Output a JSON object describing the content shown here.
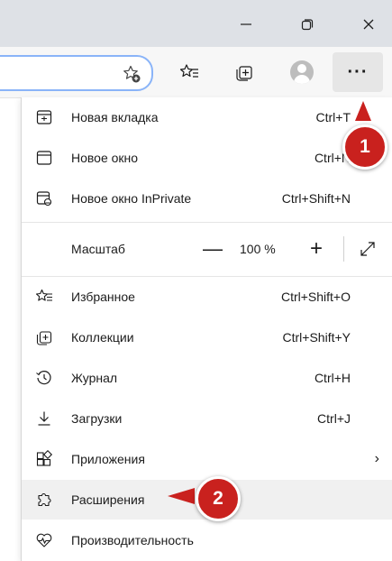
{
  "window_controls": {
    "minimize_icon": "minimize-icon",
    "restore_icon": "restore-icon",
    "close_icon": "close-icon"
  },
  "toolbar": {
    "favorites_add_icon": "star-add-icon",
    "favorites_icon": "favorites-icon",
    "collections_icon": "collections-icon",
    "profile_icon": "profile-avatar",
    "more_label": "···"
  },
  "menu": {
    "new_tab": {
      "label": "Новая вкладка",
      "shortcut": "Ctrl+T"
    },
    "new_window": {
      "label": "Новое окно",
      "shortcut": "Ctrl+N"
    },
    "new_private": {
      "label": "Новое окно InPrivate",
      "shortcut": "Ctrl+Shift+N"
    },
    "zoom": {
      "label": "Масштаб",
      "minus": "—",
      "value": "100 %",
      "plus": "+"
    },
    "favorites": {
      "label": "Избранное",
      "shortcut": "Ctrl+Shift+O"
    },
    "collections": {
      "label": "Коллекции",
      "shortcut": "Ctrl+Shift+Y"
    },
    "history": {
      "label": "Журнал",
      "shortcut": "Ctrl+H"
    },
    "downloads": {
      "label": "Загрузки",
      "shortcut": "Ctrl+J"
    },
    "apps": {
      "label": "Приложения",
      "chevron": "›"
    },
    "extensions": {
      "label": "Расширения"
    },
    "performance": {
      "label": "Производительность"
    }
  },
  "callouts": {
    "one": "1",
    "two": "2"
  },
  "colors": {
    "callout": "#c9211e",
    "titlebar": "#dee1e6",
    "address_border": "#8ab4f8"
  }
}
